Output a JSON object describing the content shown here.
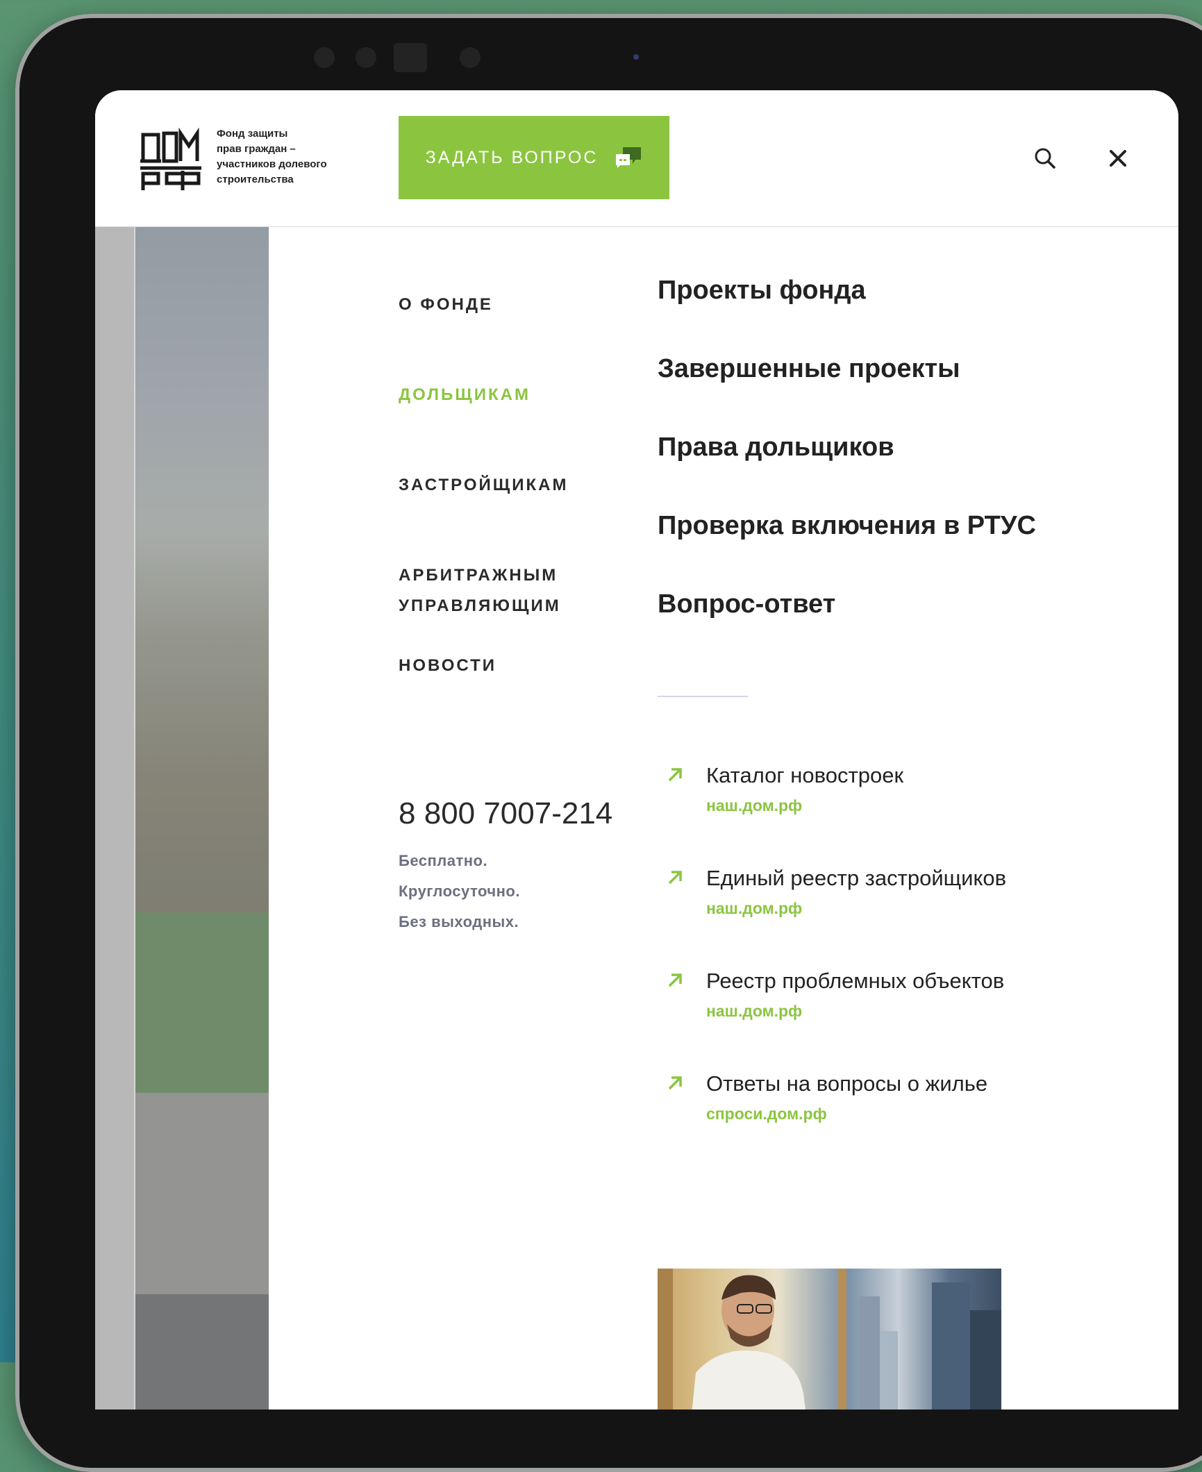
{
  "header": {
    "logo_top": "ДОМ",
    "logo_bottom": "РФ",
    "logo_text": [
      "Фонд защиты",
      "прав граждан –",
      "участников долевого",
      "строительства"
    ],
    "ask_button": "ЗАДАТЬ ВОПРОС",
    "search_icon": "search-icon",
    "close_icon": "close-icon"
  },
  "nav": {
    "items": [
      {
        "label": "О ФОНДЕ",
        "active": false
      },
      {
        "label": "ДОЛЬЩИКАМ",
        "active": true
      },
      {
        "label": "ЗАСТРОЙЩИКАМ",
        "active": false
      },
      {
        "label": "АРБИТРАЖНЫМ",
        "active": false
      },
      {
        "label": "УПРАВЛЯЮЩИМ",
        "active": false
      },
      {
        "label": "НОВОСТИ",
        "active": false
      }
    ]
  },
  "contact": {
    "phone": "8 800 7007-214",
    "notes": [
      "Бесплатно.",
      "Круглосуточно.",
      "Без выходных."
    ]
  },
  "submenu": {
    "items": [
      "Проекты фонда",
      "Завершенные проекты",
      "Права дольщиков",
      "Проверка включения в РТУС",
      "Вопрос-ответ"
    ]
  },
  "external_links": [
    {
      "title": "Каталог новостроек",
      "url": "наш.дом.рф"
    },
    {
      "title": "Единый реестр застройщиков",
      "url": "наш.дом.рф"
    },
    {
      "title": "Реестр проблемных объектов",
      "url": "наш.дом.рф"
    },
    {
      "title": "Ответы на вопросы о жилье",
      "url": "спроси.дом.рф"
    }
  ],
  "colors": {
    "accent": "#8bc540",
    "text": "#222222",
    "muted": "#6a6f80"
  }
}
